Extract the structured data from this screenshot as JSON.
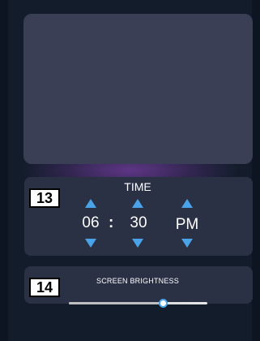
{
  "time_panel": {
    "badge": "13",
    "title": "TIME",
    "hour": "06",
    "separator": ":",
    "minute": "30",
    "period": "PM"
  },
  "brightness_panel": {
    "badge": "14",
    "label": "SCREEN BRIGHTNESS",
    "level_fraction": 0.67
  },
  "icons": {
    "increment": "arrow-up-icon",
    "decrement": "arrow-down-icon"
  },
  "colors": {
    "accent": "#4aa3e8",
    "panel": "#2b3145",
    "screen": "#3a3f55",
    "background": "#131c2b"
  }
}
